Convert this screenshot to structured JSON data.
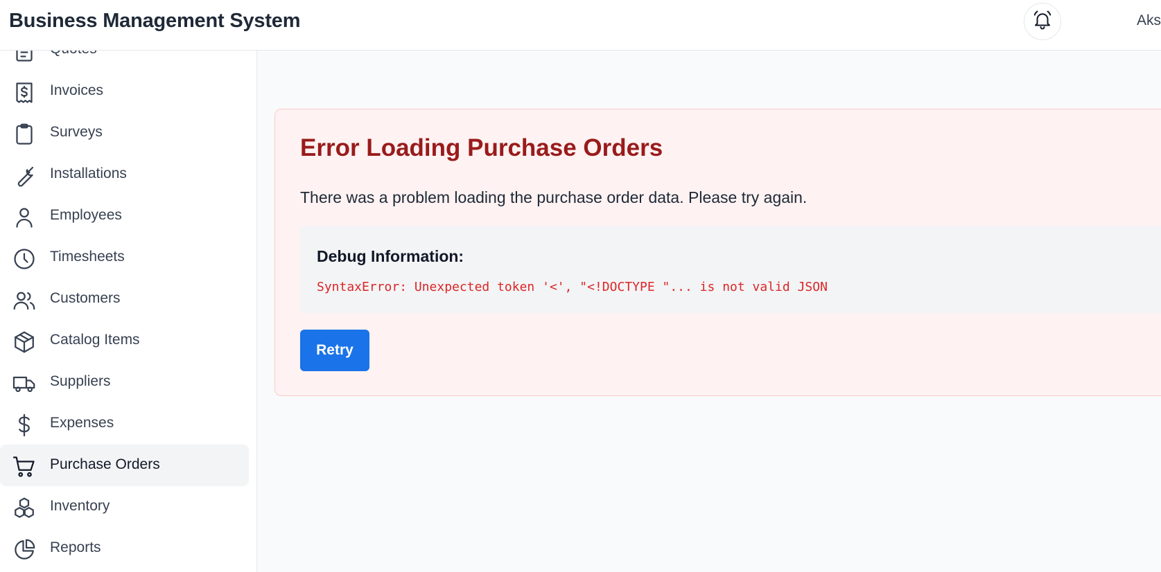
{
  "header": {
    "title": "Business Management System",
    "user_name": "Aks"
  },
  "sidebar": {
    "items": [
      {
        "label": "Quotes",
        "icon": "document-list-icon"
      },
      {
        "label": "Invoices",
        "icon": "receipt-dollar-icon"
      },
      {
        "label": "Surveys",
        "icon": "clipboard-icon"
      },
      {
        "label": "Installations",
        "icon": "wrench-icon"
      },
      {
        "label": "Employees",
        "icon": "user-icon"
      },
      {
        "label": "Timesheets",
        "icon": "clock-icon"
      },
      {
        "label": "Customers",
        "icon": "users-icon"
      },
      {
        "label": "Catalog Items",
        "icon": "cube-icon"
      },
      {
        "label": "Suppliers",
        "icon": "truck-icon"
      },
      {
        "label": "Expenses",
        "icon": "dollar-icon"
      },
      {
        "label": "Purchase Orders",
        "icon": "cart-icon",
        "active": true
      },
      {
        "label": "Inventory",
        "icon": "cubes-icon"
      },
      {
        "label": "Reports",
        "icon": "pie-chart-icon"
      }
    ]
  },
  "error": {
    "title": "Error Loading Purchase Orders",
    "message": "There was a problem loading the purchase order data. Please try again.",
    "debug_title": "Debug Information:",
    "debug_text": "SyntaxError: Unexpected token '<', \"<!DOCTYPE \"... is not valid JSON",
    "retry_label": "Retry"
  },
  "colors": {
    "accent": "#1a73e8",
    "error_title": "#991b1b",
    "error_bg": "#fef2f2",
    "debug_text": "#dc2626"
  }
}
